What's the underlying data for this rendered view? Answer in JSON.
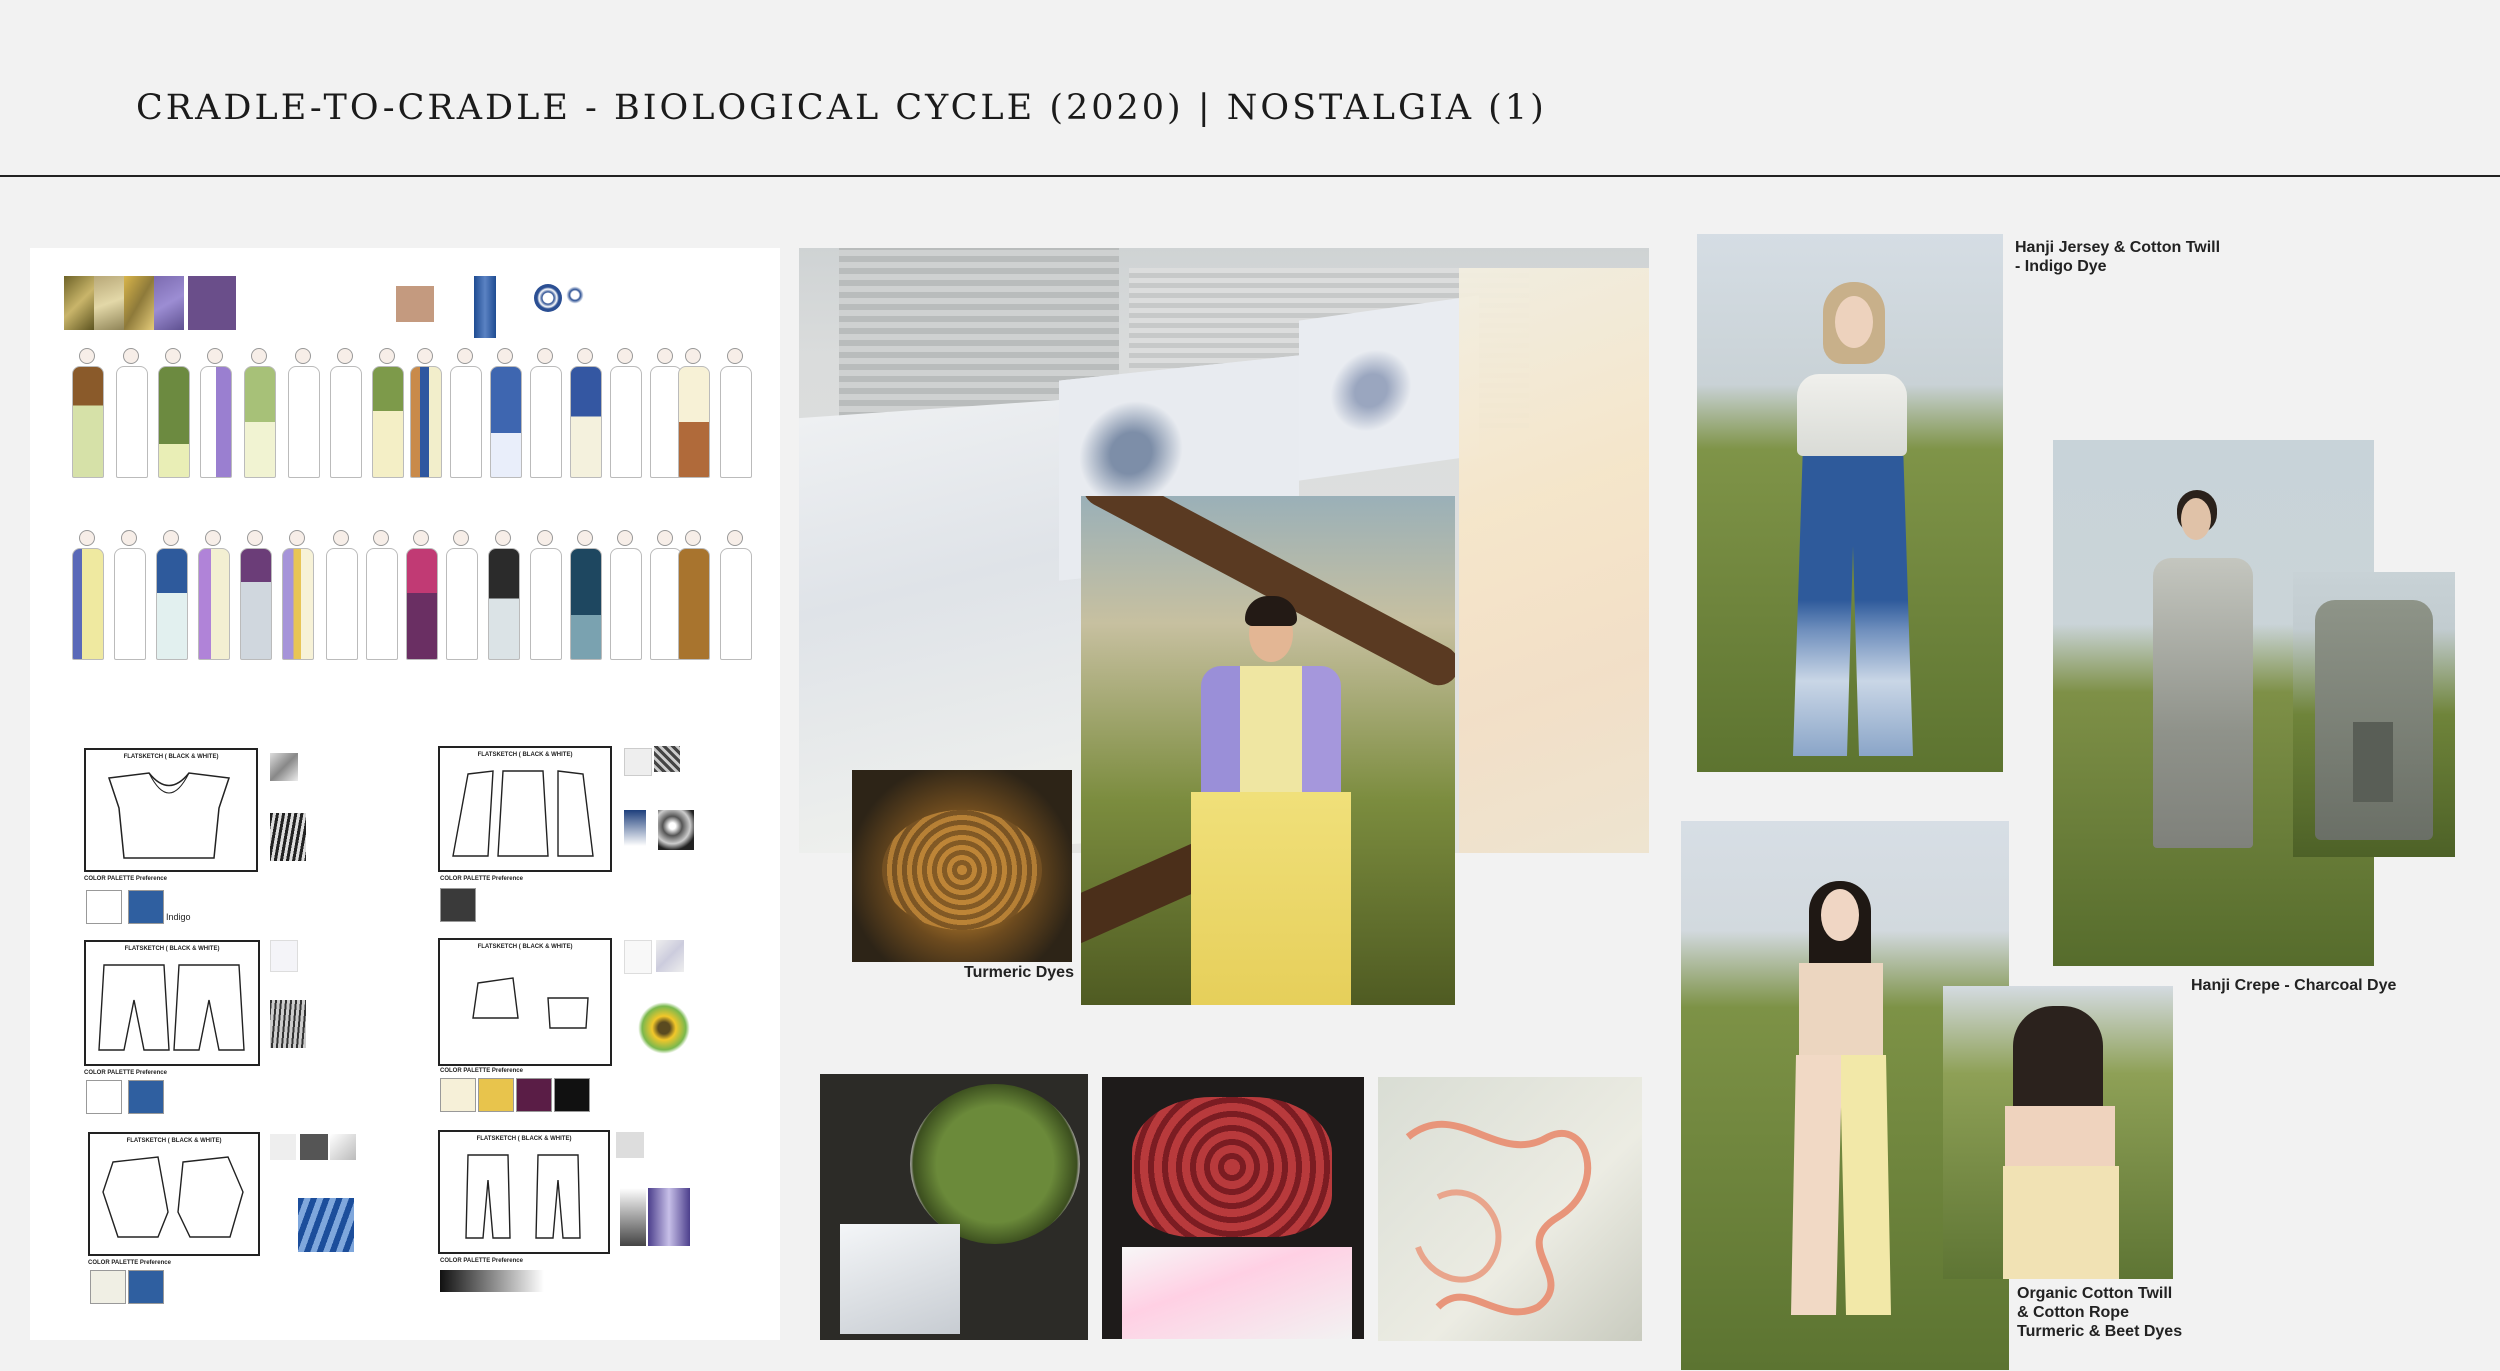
{
  "page": {
    "title": "CRADLE-TO-CRADLE - BIOLOGICAL CYCLE (2020) | NOSTALGIA (1)"
  },
  "sheet": {
    "flat_header": "FLATSKETCH ( BLACK & WHITE)",
    "palette_label": "COLOR PALETTE Preference",
    "indigo_label": "Indigo"
  },
  "captions": {
    "turmeric": "Turmeric Dyes",
    "hanji_jersey_line1": "Hanji Jersey  & Cotton Twill",
    "hanji_jersey_line2": "- Indigo Dye",
    "hanji_crepe": "Hanji Crepe - Charcoal Dye",
    "organic_line1": "Organic Cotton Twill",
    "organic_line2": "& Cotton Rope",
    "organic_line3": "Turmeric & Beet Dyes"
  },
  "colors": {
    "background": "#f2f2f2",
    "indigo": "#2f5fa0",
    "charcoal": "#3a3a3a",
    "turmeric": "#e8c44c",
    "beet": "#5a1d46",
    "lavender": "#9f8ed6",
    "pale_yellow": "#efe6a2",
    "olive": "#8da85a"
  }
}
